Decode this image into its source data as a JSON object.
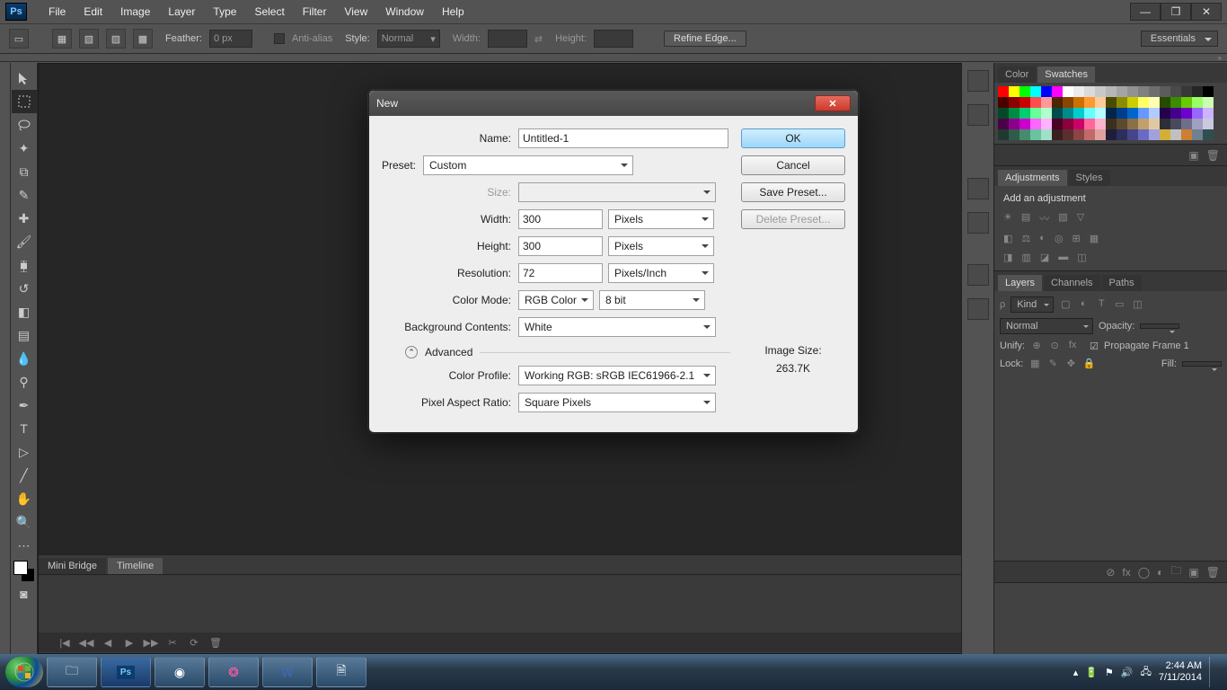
{
  "menubar": {
    "items": [
      "File",
      "Edit",
      "Image",
      "Layer",
      "Type",
      "Select",
      "Filter",
      "View",
      "Window",
      "Help"
    ]
  },
  "optionsbar": {
    "feather_label": "Feather:",
    "feather_value": "0 px",
    "antialias_label": "Anti-alias",
    "style_label": "Style:",
    "style_value": "Normal",
    "width_label": "Width:",
    "height_label": "Height:",
    "refine_label": "Refine Edge...",
    "workspace": "Essentials"
  },
  "dialog": {
    "title": "New",
    "labels": {
      "name": "Name:",
      "preset": "Preset:",
      "size": "Size:",
      "width": "Width:",
      "height": "Height:",
      "resolution": "Resolution:",
      "color_mode": "Color Mode:",
      "bg": "Background Contents:",
      "advanced": "Advanced",
      "profile": "Color Profile:",
      "par": "Pixel Aspect Ratio:",
      "imgsize": "Image Size:"
    },
    "values": {
      "name": "Untitled-1",
      "preset": "Custom",
      "width": "300",
      "width_unit": "Pixels",
      "height": "300",
      "height_unit": "Pixels",
      "resolution": "72",
      "res_unit": "Pixels/Inch",
      "color_mode": "RGB Color",
      "bit": "8 bit",
      "bg": "White",
      "profile": "Working RGB: sRGB IEC61966-2.1",
      "par": "Square Pixels",
      "imgsize": "263.7K"
    },
    "buttons": {
      "ok": "OK",
      "cancel": "Cancel",
      "save": "Save Preset...",
      "delete": "Delete Preset..."
    }
  },
  "right_panels": {
    "color_tab": "Color",
    "swatches_tab": "Swatches",
    "adjust_tab": "Adjustments",
    "styles_tab": "Styles",
    "adjust_text": "Add an adjustment",
    "layers_tab": "Layers",
    "channels_tab": "Channels",
    "paths_tab": "Paths",
    "layers": {
      "kind": "Kind",
      "blend": "Normal",
      "opacity": "Opacity:",
      "unify": "Unify:",
      "propagate": "Propagate Frame 1",
      "lock": "Lock:",
      "fill": "Fill:"
    }
  },
  "bottom_panel": {
    "tabs": [
      "Mini Bridge",
      "Timeline"
    ]
  },
  "taskbar": {
    "time": "2:44 AM",
    "date": "7/11/2014"
  },
  "swatch_colors": [
    "#ff0000",
    "#ffff00",
    "#00ff00",
    "#00ffff",
    "#0000ff",
    "#ff00ff",
    "#ffffff",
    "#ececec",
    "#dadada",
    "#c8c8c8",
    "#b6b6b6",
    "#a4a4a4",
    "#929292",
    "#808080",
    "#6e6e6e",
    "#5c5c5c",
    "#4a4a4a",
    "#383838",
    "#262626",
    "#000000",
    "#4b0000",
    "#8b0000",
    "#cc0000",
    "#ff4d4d",
    "#ff9999",
    "#4b2600",
    "#8b4500",
    "#cc7000",
    "#ff9933",
    "#ffcc99",
    "#4b4b00",
    "#8b8b00",
    "#cccc00",
    "#ffff66",
    "#ffffb3",
    "#264b00",
    "#3d8b00",
    "#66cc00",
    "#99ff66",
    "#ccffb3",
    "#004b26",
    "#008b45",
    "#00cc70",
    "#66ff99",
    "#b3ffcc",
    "#004b4b",
    "#008b8b",
    "#00cccc",
    "#66ffff",
    "#b3ffff",
    "#00264b",
    "#003d8b",
    "#0066cc",
    "#6699ff",
    "#b3ccff",
    "#26004b",
    "#45008b",
    "#7000cc",
    "#9966ff",
    "#ccb3ff",
    "#4b004b",
    "#8b008b",
    "#cc00cc",
    "#ff66ff",
    "#ffb3ff",
    "#4b0026",
    "#8b003d",
    "#cc0066",
    "#ff6699",
    "#ffb3cc",
    "#3b2f1e",
    "#5c4a2e",
    "#8b6f45",
    "#c2a06a",
    "#e0c9a0",
    "#2e2e3b",
    "#4a4a5c",
    "#6f6f8b",
    "#a0a0c2",
    "#c9c9e0",
    "#1e3b2f",
    "#2e5c4a",
    "#458b6f",
    "#6ac2a0",
    "#a0e0c9",
    "#3b1e1e",
    "#5c2e2e",
    "#8b4545",
    "#c26a6a",
    "#e0a0a0",
    "#1e1e3b",
    "#2e2e5c",
    "#45458b",
    "#6a6ac2",
    "#a0a0e0",
    "#d4af37",
    "#c0c0c0",
    "#cd7f32",
    "#708090",
    "#2f4f4f"
  ]
}
